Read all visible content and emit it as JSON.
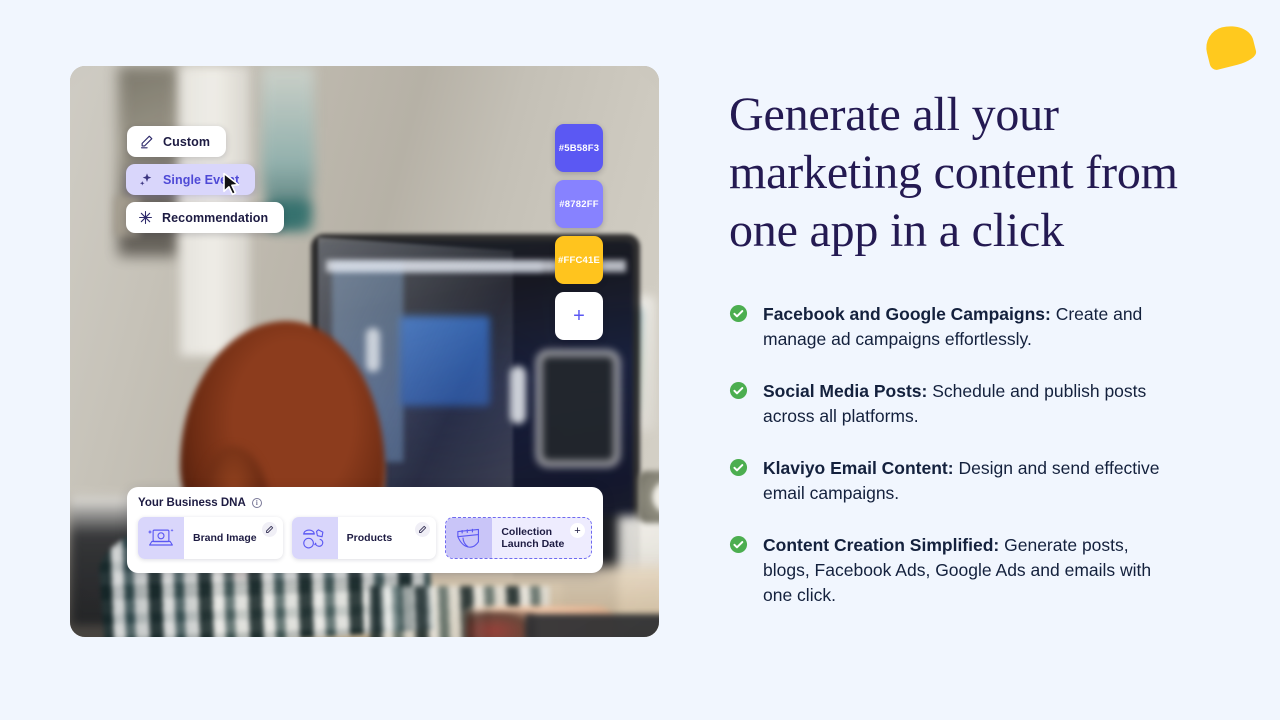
{
  "theme": {
    "background": "#f1f6fe",
    "heading_color": "#241a52",
    "body_color": "#14213d",
    "accent_purple": "#5b58f3",
    "accent_lavender": "#d9d6fb",
    "check_green": "#4cae50",
    "leaf_yellow": "#ffc91e"
  },
  "decoration": {
    "leaf_shape": "leaf-shape"
  },
  "hero": {
    "headline": "Generate all your marketing content from one app in a click"
  },
  "features": [
    {
      "icon": "check-circle-icon",
      "title": "Facebook and Google Campaigns:",
      "description": "Create and manage ad campaigns effortlessly."
    },
    {
      "icon": "check-circle-icon",
      "title": "Social Media Posts:",
      "description": "Schedule and publish posts across all platforms."
    },
    {
      "icon": "check-circle-icon",
      "title": "Klaviyo Email Content:",
      "description": "Design and send effective email campaigns."
    },
    {
      "icon": "check-circle-icon",
      "title": "Content Creation Simplified:",
      "description": "Generate posts, blogs, Facebook Ads, Google Ads and emails with one click."
    }
  ],
  "screenshot_panel": {
    "photo_alt": "woman with red hair in plaid shirt working at a desktop computer",
    "chips": [
      {
        "label": "Custom",
        "icon": "pencil-icon",
        "active": false
      },
      {
        "label": "Single Event",
        "icon": "sparkle-icon",
        "active": true
      },
      {
        "label": "Recommendation",
        "icon": "asterisk-icon",
        "active": false
      }
    ],
    "cursor": {
      "icon": "mouse-pointer-icon"
    },
    "swatches": [
      {
        "hex": "#5B58F3"
      },
      {
        "hex": "#8782FF"
      },
      {
        "hex": "#FFC41E"
      }
    ],
    "add_swatch_label": "+",
    "business_dna": {
      "title": "Your Business DNA",
      "info_icon": "info-icon",
      "info_glyph": "i",
      "tiles": [
        {
          "label": "Brand Image",
          "icon": "laptop-sparkle-icon",
          "action_icon": "pencil-icon",
          "action_glyph": "",
          "dashed": false
        },
        {
          "label": "Products",
          "icon": "products-icon",
          "action_icon": "pencil-icon",
          "action_glyph": "",
          "dashed": false
        },
        {
          "label": "Collection Launch Date",
          "icon": "calendar-icon",
          "action_icon": "plus-icon",
          "action_glyph": "+",
          "dashed": true
        }
      ]
    }
  }
}
